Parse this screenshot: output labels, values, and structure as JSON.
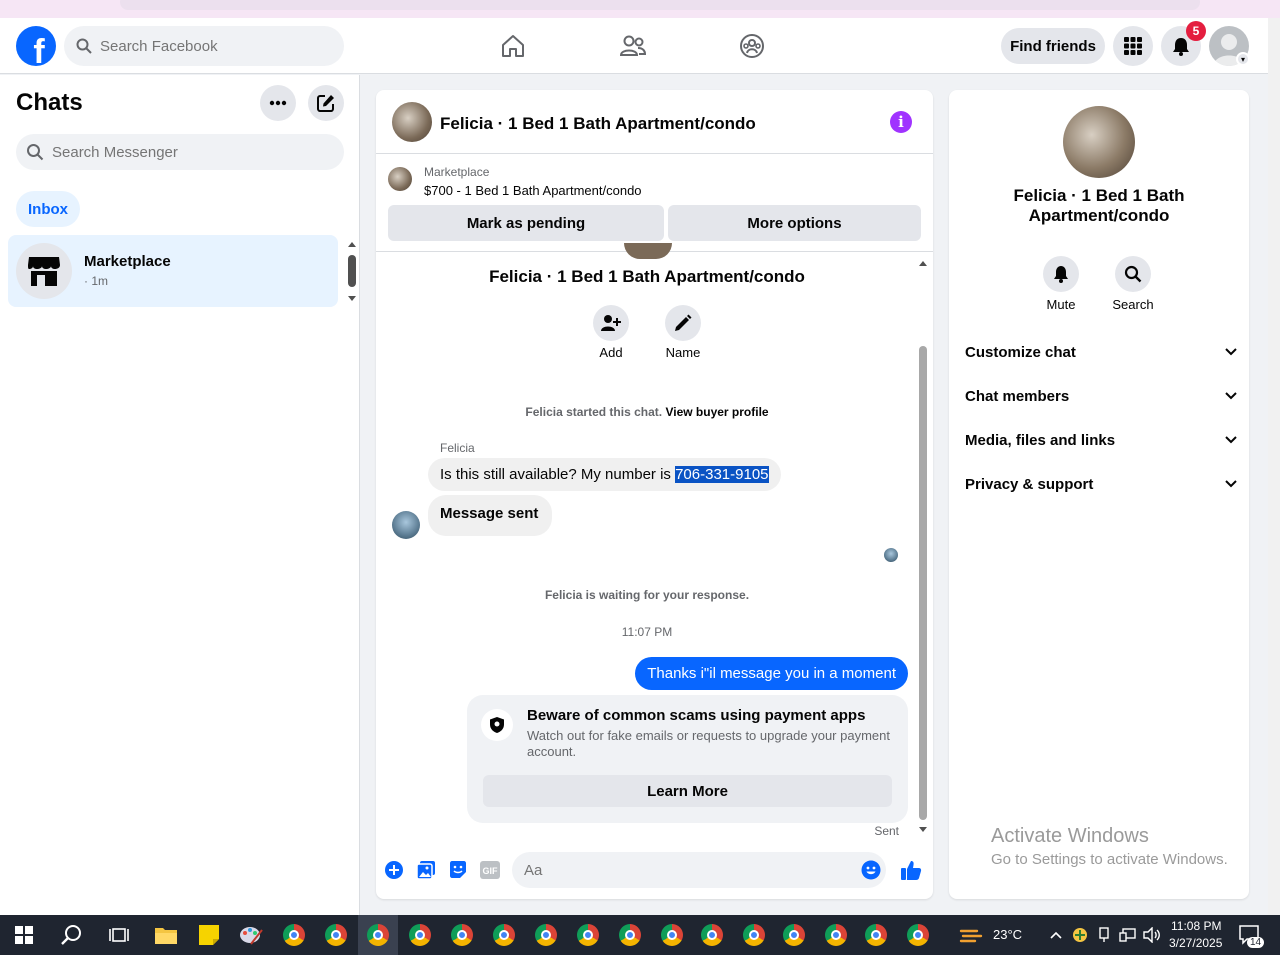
{
  "topbar": {
    "logo_letter": "f",
    "search_placeholder": "Search Facebook",
    "find_friends_label": "Find friends",
    "notification_count": "5"
  },
  "sidebar": {
    "title": "Chats",
    "search_placeholder": "Search Messenger",
    "inbox_label": "Inbox",
    "chat_items": [
      {
        "name": "Marketplace",
        "time": "· 1m"
      }
    ]
  },
  "conversation": {
    "title": "Felicia · 1 Bed 1 Bath Apartment/condo",
    "marketplace": {
      "label": "Marketplace",
      "listing": "$700 - 1 Bed 1 Bath Apartment/condo",
      "mark_pending_label": "Mark as pending",
      "more_options_label": "More options"
    },
    "thread_name": "Felicia · 1 Bed 1 Bath Apartment/condo",
    "actions": {
      "add_label": "Add",
      "name_label": "Name"
    },
    "started_text": "Felicia started this chat.",
    "view_profile_label": "View buyer profile",
    "sender_name": "Felicia",
    "incoming_text": "Is this still available? My number is ",
    "phone_number": "706-331-9105",
    "message_sent_text": "Message sent",
    "waiting_text": "Felicia is waiting for your response.",
    "timestamp": "11:07 PM",
    "outgoing_text": "Thanks i\"il message you in a moment",
    "scam_card": {
      "title": "Beware of common scams using payment apps",
      "body": "Watch out for fake emails or requests to upgrade your payment account.",
      "button_label": "Learn More"
    },
    "sent_status": "Sent",
    "composer_placeholder": "Aa",
    "gif_label": "GIF"
  },
  "right_panel": {
    "name": "Felicia · 1 Bed 1 Bath Apartment/condo",
    "mute_label": "Mute",
    "search_label": "Search",
    "sections": [
      {
        "label": "Customize chat"
      },
      {
        "label": "Chat members"
      },
      {
        "label": "Media, files and links"
      },
      {
        "label": "Privacy & support"
      }
    ]
  },
  "watermark": {
    "title": "Activate Windows",
    "subtitle": "Go to Settings to activate Windows."
  },
  "taskbar": {
    "weather": "23°C",
    "time": "11:08 PM",
    "date": "3/27/2025",
    "notification_count": "14"
  },
  "colors": {
    "brand": "#0866ff",
    "info_purple": "#a033ff",
    "badge_red": "#e41e3f"
  }
}
